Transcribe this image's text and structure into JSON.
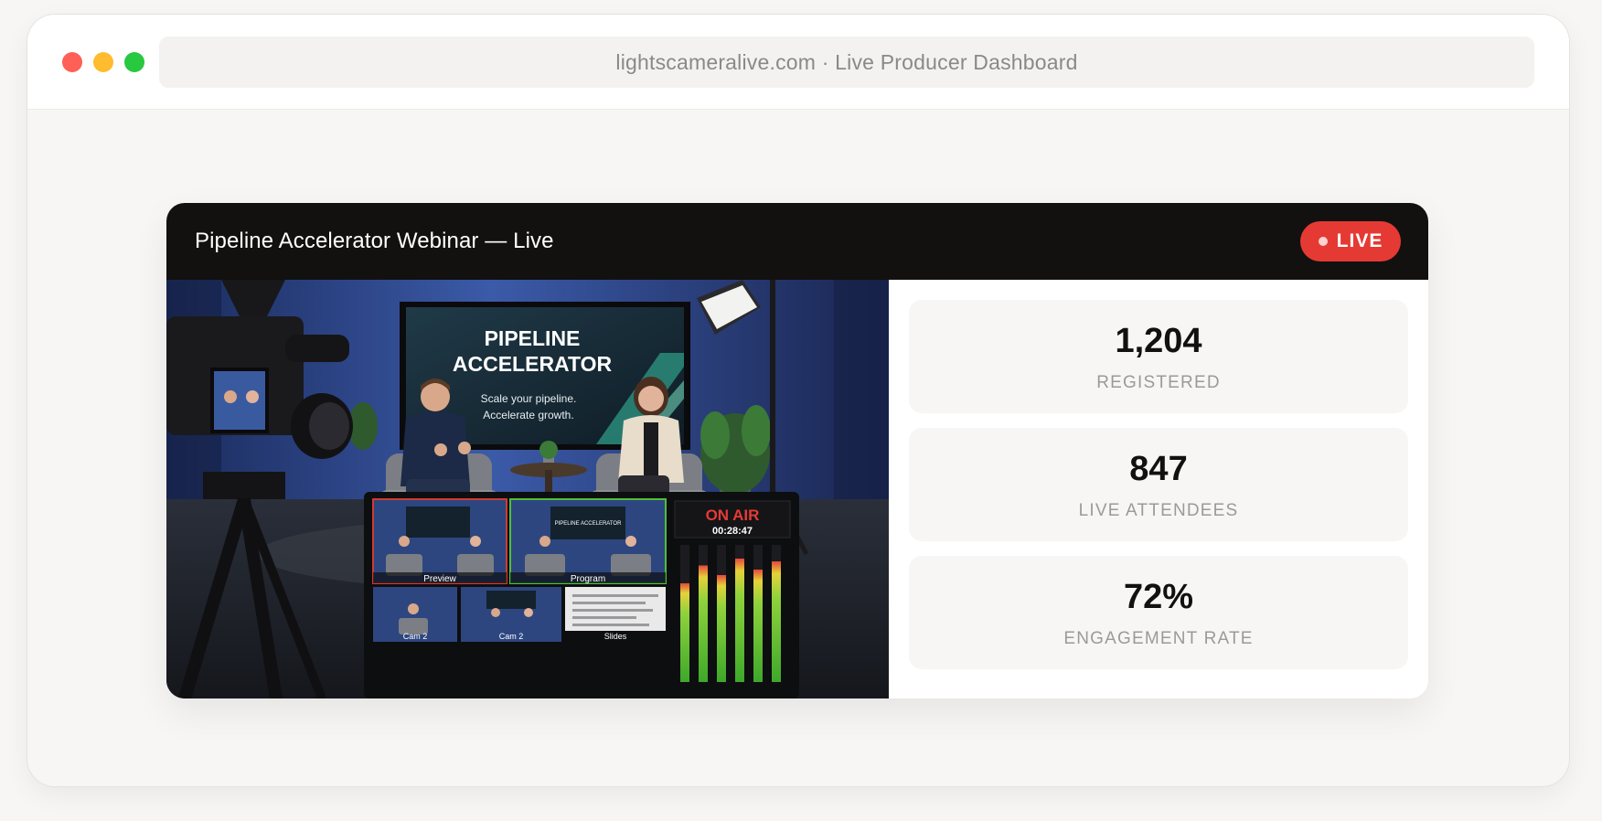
{
  "browser": {
    "url": "lightscameralive.com · Live Producer Dashboard"
  },
  "card": {
    "title": "Pipeline Accelerator Webinar — Live",
    "live_label": "LIVE"
  },
  "video": {
    "screen_title_line1": "PIPELINE",
    "screen_title_line2": "ACCELERATOR",
    "screen_sub_line1": "Scale your pipeline.",
    "screen_sub_line2": "Accelerate growth.",
    "mini_title": "PIPELINE ACCELERATOR",
    "monitor": {
      "preview_label": "Preview",
      "program_label": "Program",
      "cam_labels": [
        "Cam 2",
        "Cam 2",
        "Slides"
      ],
      "on_air_label": "ON AIR",
      "timecode": "00:28:47"
    }
  },
  "stats": [
    {
      "value": "1,204",
      "label": "REGISTERED"
    },
    {
      "value": "847",
      "label": "LIVE ATTENDEES"
    },
    {
      "value": "72%",
      "label": "ENGAGEMENT RATE"
    }
  ],
  "colors": {
    "live": "#e53a33",
    "header": "#121110",
    "on_air": "#e53a33",
    "meter_green": "#5fbf3a"
  }
}
